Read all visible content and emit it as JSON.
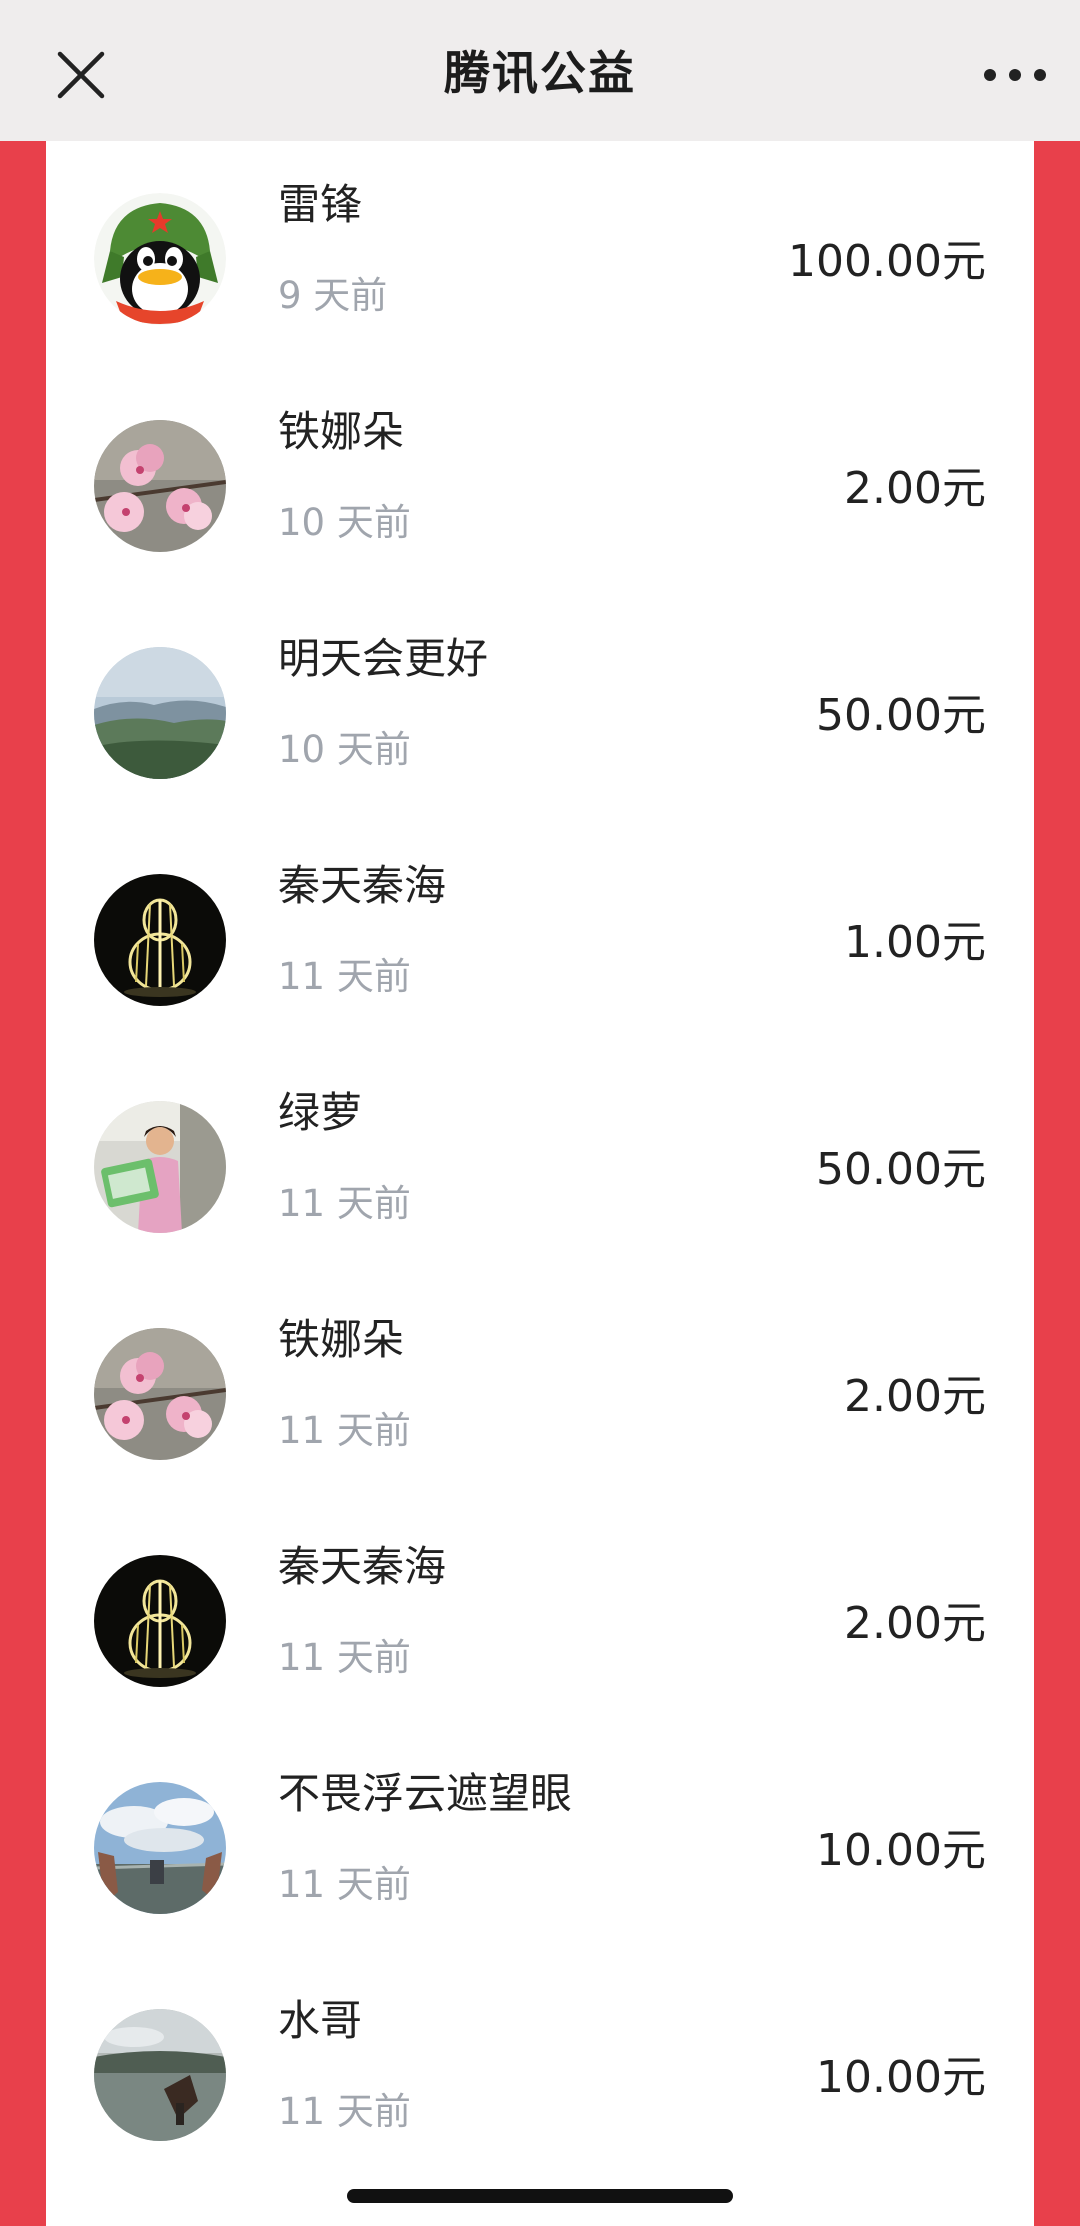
{
  "header": {
    "title": "腾讯公益",
    "close_icon": "close-icon",
    "more_icon": "more-horizontal-icon"
  },
  "colors": {
    "accent_red": "#e8404b",
    "header_bg": "#efeded",
    "time_gray": "#a0a5ad",
    "text_dark": "#222222"
  },
  "donations": [
    {
      "name": "雷锋",
      "time": "9 天前",
      "amount": "100.00元",
      "avatar": "qq-penguin-avatar"
    },
    {
      "name": "铁娜朵",
      "time": "10 天前",
      "amount": "2.00元",
      "avatar": "pink-blossom-avatar"
    },
    {
      "name": "明天会更好",
      "time": "10 天前",
      "amount": "50.00元",
      "avatar": "mountain-landscape-avatar"
    },
    {
      "name": "秦天秦海",
      "time": "11 天前",
      "amount": "1.00元",
      "avatar": "gourd-lights-avatar"
    },
    {
      "name": "绿萝",
      "time": "11 天前",
      "amount": "50.00元",
      "avatar": "girl-photo-avatar"
    },
    {
      "name": "铁娜朵",
      "time": "11 天前",
      "amount": "2.00元",
      "avatar": "pink-blossom-avatar"
    },
    {
      "name": "秦天秦海",
      "time": "11 天前",
      "amount": "2.00元",
      "avatar": "gourd-lights-avatar"
    },
    {
      "name": "不畏浮云遮望眼",
      "time": "11 天前",
      "amount": "10.00元",
      "avatar": "sky-hands-avatar"
    },
    {
      "name": "水哥",
      "time": "11 天前",
      "amount": "10.00元",
      "avatar": "lakeside-avatar"
    }
  ]
}
